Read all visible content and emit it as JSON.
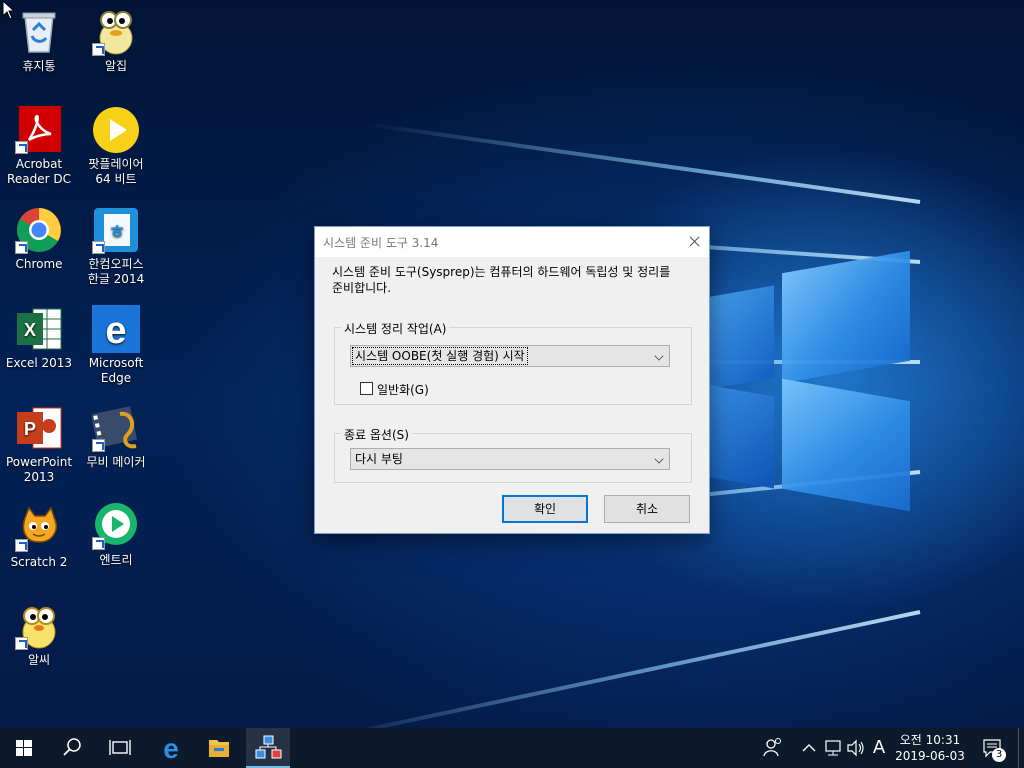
{
  "desktop": {
    "icons": [
      {
        "label": "휴지통"
      },
      {
        "label": "알집"
      },
      {
        "label": "Acrobat\nReader DC"
      },
      {
        "label": "팟플레이어\n64 비트"
      },
      {
        "label": "Chrome"
      },
      {
        "label": "한컴오피스\n한글 2014"
      },
      {
        "label": "Excel 2013"
      },
      {
        "label": "Microsoft\nEdge"
      },
      {
        "label": "PowerPoint\n2013"
      },
      {
        "label": "무비 메이커"
      },
      {
        "label": "Scratch 2"
      },
      {
        "label": "엔트리"
      },
      {
        "label": "알씨"
      }
    ]
  },
  "dialog": {
    "title": "시스템 준비 도구 3.14",
    "description": "시스템 준비 도구(Sysprep)는 컴퓨터의 하드웨어 독립성 및 정리를\n준비합니다.",
    "cleanup_group": {
      "label": "시스템 정리 작업(A)",
      "selected": "시스템 OOBE(첫 실행 경험) 시작",
      "generalize_label": "일반화(G)",
      "generalize_checked": false
    },
    "shutdown_group": {
      "label": "종료 옵션(S)",
      "selected": "다시 부팅"
    },
    "ok_label": "확인",
    "cancel_label": "취소"
  },
  "taskbar": {
    "ime_indicator": "A",
    "time": "오전 10:31",
    "date": "2019-06-03",
    "notification_count": "3"
  },
  "colors": {
    "accent": "#0078d7",
    "taskbar": "#0d1a2c"
  }
}
